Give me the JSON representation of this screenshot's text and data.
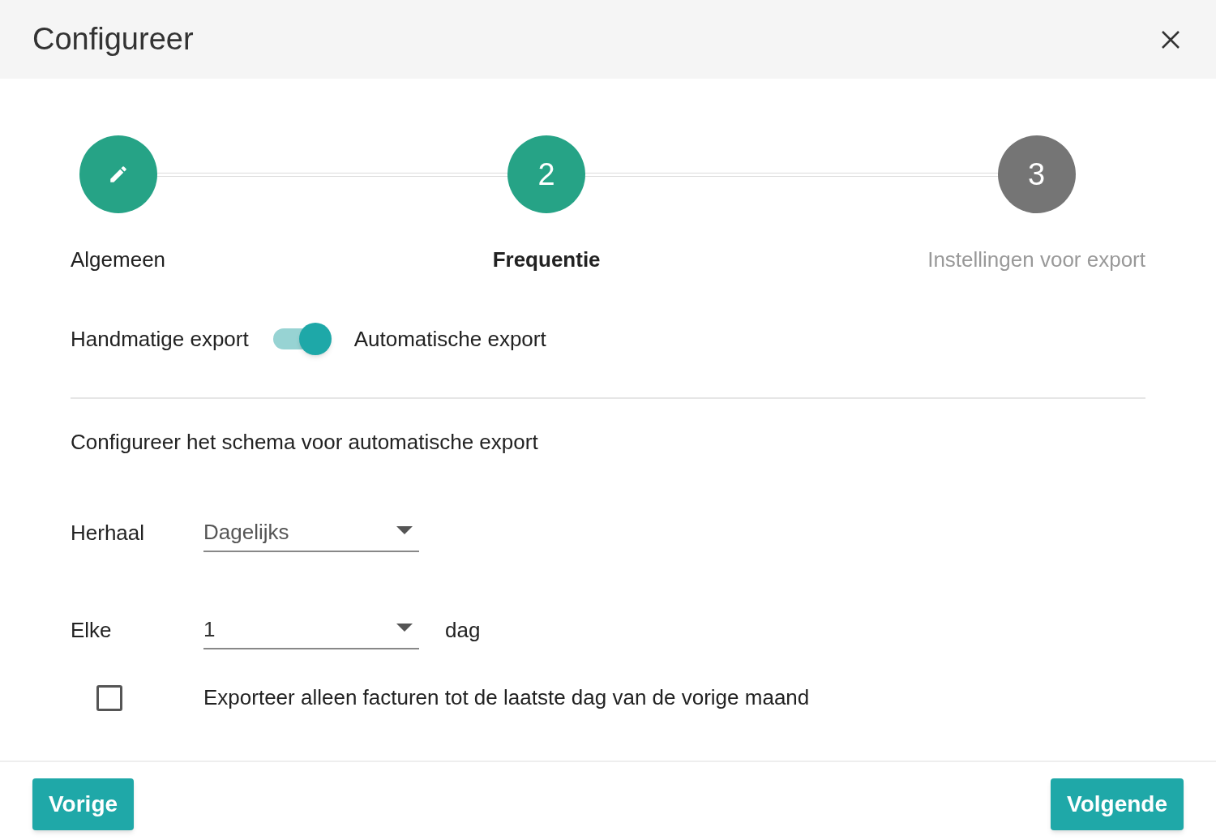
{
  "dialog": {
    "title": "Configureer"
  },
  "steps": [
    {
      "kind": "edit",
      "label": "Algemeen",
      "selected": false
    },
    {
      "kind": "number",
      "number": "2",
      "label": "Frequentie",
      "selected": true
    },
    {
      "kind": "number",
      "number": "3",
      "label": "Instellingen voor export",
      "selected": false
    }
  ],
  "export_mode": {
    "left_label": "Handmatige export",
    "right_label": "Automatische export",
    "on": true
  },
  "schedule_heading": "Configureer het schema voor automatische export",
  "fields": [
    {
      "label": "Herhaal",
      "value": "Dagelijks"
    },
    {
      "label": "Elke",
      "value": "1",
      "suffix": "dag"
    }
  ],
  "only_previous_month": {
    "label": "Exporteer alleen facturen tot de laatste dag van de vorige maand",
    "checked": false
  },
  "buttons": [
    {
      "label": "Vorige"
    },
    {
      "label": "Volgende"
    }
  ]
}
